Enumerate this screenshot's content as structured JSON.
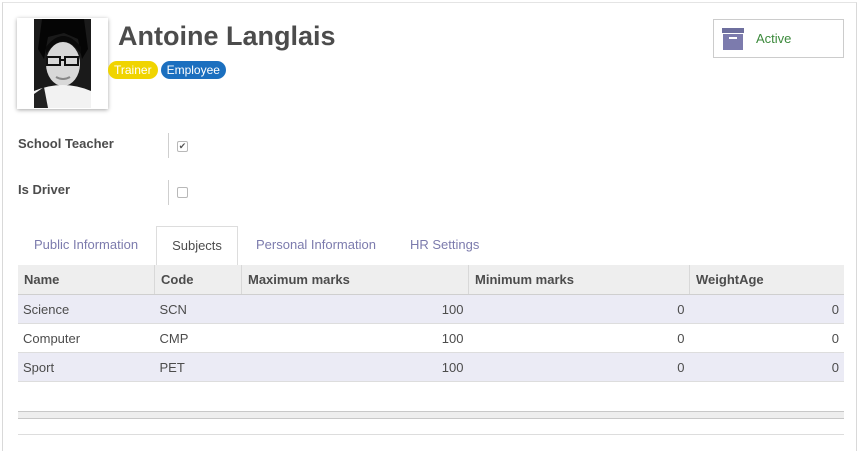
{
  "profile": {
    "name": "Antoine Langlais",
    "tags": [
      {
        "label": "Trainer",
        "color": "#f0d400"
      },
      {
        "label": "Employee",
        "color": "#1b6fbf"
      }
    ],
    "avatar_icon": "person-photo"
  },
  "status_button": {
    "label": "Active",
    "icon": "archive-box-icon",
    "color": "#3c8a3c"
  },
  "fields": [
    {
      "label": "School Teacher",
      "checked": true
    },
    {
      "label": "Is Driver",
      "checked": false
    }
  ],
  "tabs": [
    {
      "label": "Public Information",
      "active": false
    },
    {
      "label": "Subjects",
      "active": true
    },
    {
      "label": "Personal Information",
      "active": false
    },
    {
      "label": "HR Settings",
      "active": false
    }
  ],
  "subjects_table": {
    "columns": [
      "Name",
      "Code",
      "Maximum marks",
      "Minimum marks",
      "WeightAge"
    ],
    "rows": [
      {
        "name": "Science",
        "code": "SCN",
        "max": "100",
        "min": "0",
        "weight": "0"
      },
      {
        "name": "Computer",
        "code": "CMP",
        "max": "100",
        "min": "0",
        "weight": "0"
      },
      {
        "name": "Sport",
        "code": "PET",
        "max": "100",
        "min": "0",
        "weight": "0"
      }
    ]
  },
  "colors": {
    "accent": "#7c7bad",
    "row_highlight": "#ebebf5"
  }
}
